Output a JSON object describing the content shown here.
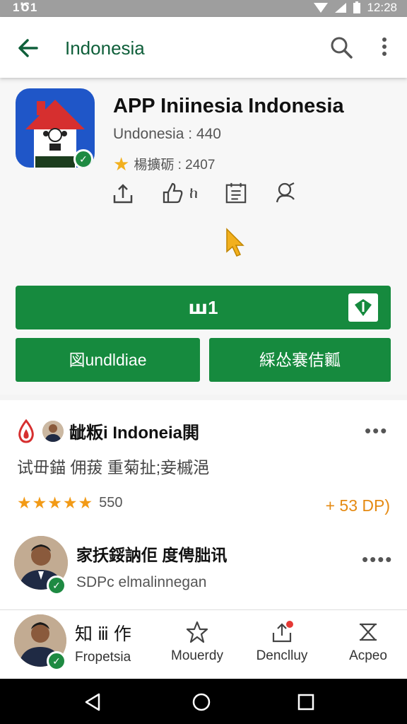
{
  "status_bar": {
    "time_left": "1Ծ1",
    "time_right": "12:28"
  },
  "app_bar": {
    "title": "Indonesia"
  },
  "app": {
    "name": "APP Iniinesia Indonesia",
    "developer": "Undonesia  : 440",
    "rating_text": "楊擴砺 : 2407",
    "colors": {
      "accent": "#168a3e",
      "icon_bg": "#1f56c8",
      "roof": "#d62f2f"
    }
  },
  "actions": {
    "like_suffix": "ከ"
  },
  "buttons": {
    "primary": "ꟺ1",
    "secondary_left": "図undldiae",
    "secondary_right": "綵怂褰佶瓤"
  },
  "review": {
    "title": "龇粄i Indoneia閧",
    "text": "试毌錨 佣菝 重菊扯;妾槭浥",
    "stars_display": "★★★★★",
    "rating_count": "550",
    "price": "+ 53 DP)"
  },
  "user": {
    "name": "家扷鋖訥佢 度俜朏讯",
    "subtitle": "SDPc elmalinnegan"
  },
  "bottom_nav": {
    "profile_title": "知 ⅲ 作",
    "profile_label": "Fropetsia",
    "items": [
      {
        "label": "Mouerdy",
        "icon": "star-icon"
      },
      {
        "label": "Denclluy",
        "icon": "share-icon"
      },
      {
        "label": "Acpeo",
        "icon": "close-box-icon"
      }
    ]
  }
}
